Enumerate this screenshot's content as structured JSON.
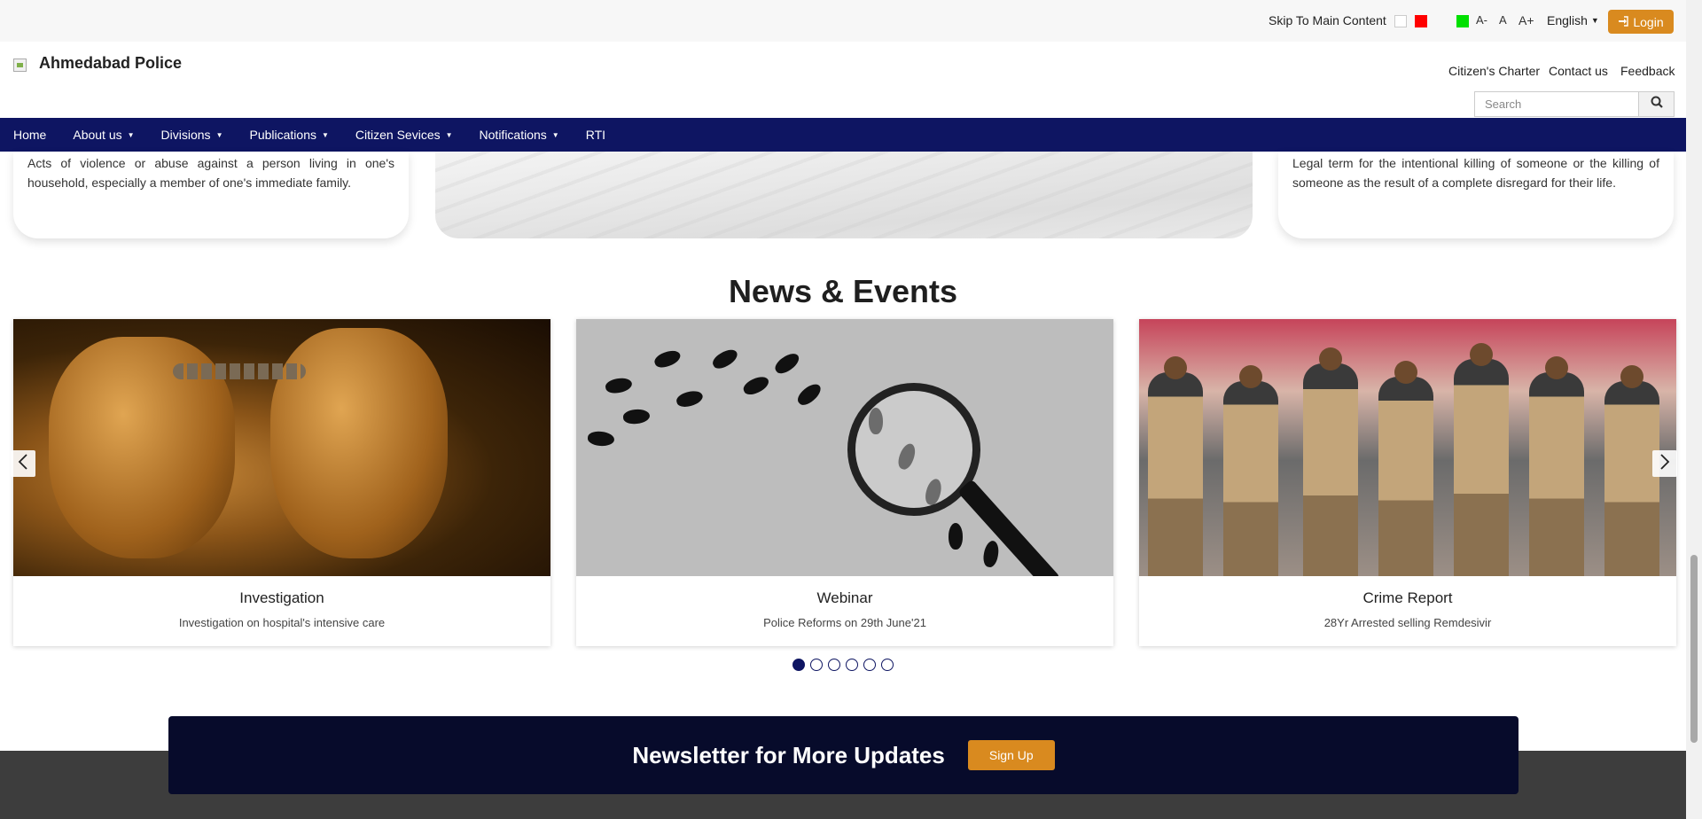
{
  "topbar": {
    "skip_label": "Skip To Main Content",
    "font_minus": "A-",
    "font_normal": "A",
    "font_plus": "A+",
    "language": "English",
    "login_label": "Login",
    "theme_colors": {
      "white": "#ffffff",
      "red": "#ff0000",
      "green": "#00e000"
    }
  },
  "header": {
    "site_title": "Ahmedabad Police",
    "links": {
      "charter": "Citizen's Charter",
      "contact": "Contact us",
      "feedback": "Feedback"
    },
    "search_placeholder": "Search"
  },
  "nav": {
    "items": [
      {
        "label": "Home",
        "dropdown": false
      },
      {
        "label": "About us",
        "dropdown": true
      },
      {
        "label": "Divisions",
        "dropdown": true
      },
      {
        "label": "Publications",
        "dropdown": true
      },
      {
        "label": "Citizen Sevices",
        "dropdown": true
      },
      {
        "label": "Notifications",
        "dropdown": true
      },
      {
        "label": "RTI",
        "dropdown": false
      }
    ]
  },
  "crime_cards": {
    "left_text": "Acts of violence or abuse against a person living in one's household, especially a member of one's immediate family.",
    "right_text": "Legal term for the intentional killing of someone or the killing of someone as the result of a complete disregard for their life."
  },
  "news": {
    "heading": "News & Events",
    "cards": [
      {
        "title": "Investigation",
        "subtitle": "Investigation on hospital's intensive care",
        "image": "handcuffs-photo"
      },
      {
        "title": "Webinar",
        "subtitle": "Police Reforms on 29th June'21",
        "image": "magnifying-glass-footprints-photo"
      },
      {
        "title": "Crime Report",
        "subtitle": "28Yr Arrested selling Remdesivir",
        "image": "police-officers-photo"
      }
    ],
    "pager_count": 6,
    "pager_active": 1
  },
  "newsletter": {
    "title": "Newsletter for More Updates",
    "signup_label": "Sign Up"
  },
  "colors": {
    "nav_bg": "#0e1562",
    "accent_orange": "#d98a1f",
    "newsletter_bg": "#070b2b",
    "footer_bg": "#3d3d3d"
  }
}
